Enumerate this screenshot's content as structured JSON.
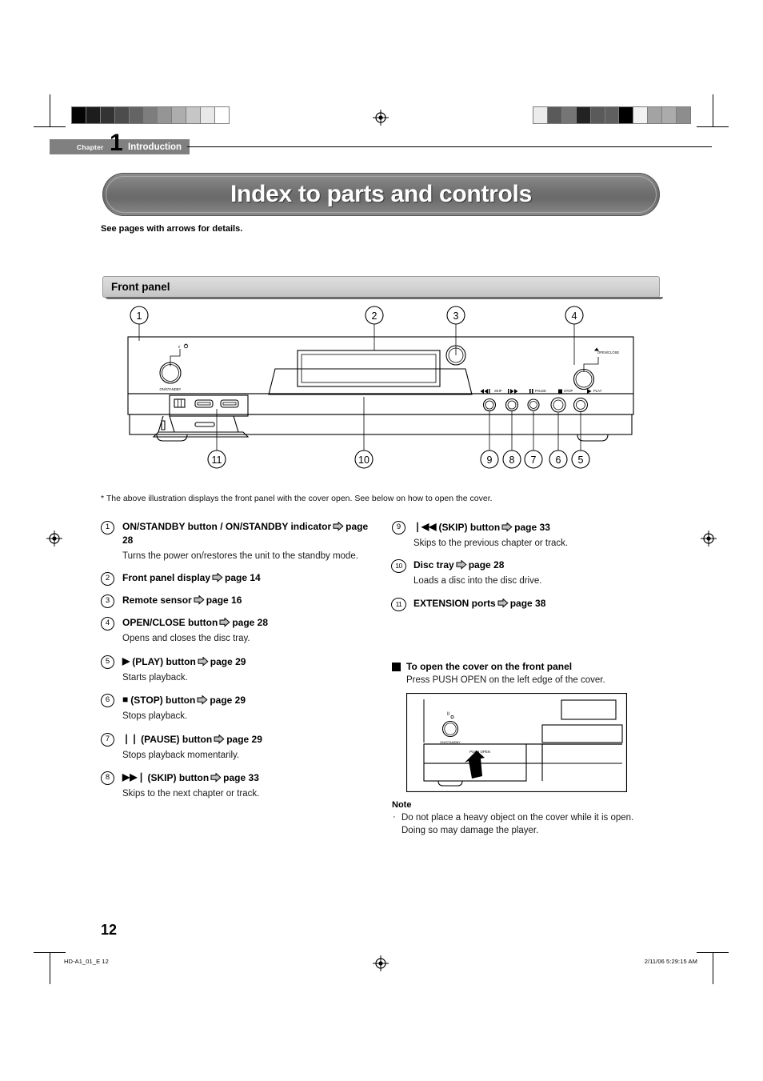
{
  "chapter": {
    "label": "Chapter",
    "number": "1",
    "section": "Introduction"
  },
  "title": "Index to parts and controls",
  "subtitle": "See pages with arrows for details.",
  "section_header": "Front panel",
  "footnote": "* The above illustration displays the front panel with the cover open. See below on how to open the cover.",
  "diagram": {
    "callouts_top": [
      "1",
      "2",
      "3",
      "4"
    ],
    "callouts_bottom": [
      "11",
      "10",
      "9",
      "8",
      "7",
      "6",
      "5"
    ],
    "labels": {
      "power_symbol": "I/⏻",
      "on_standby": "ON/STANDBY",
      "open_close": "OPEN/CLOSE",
      "skip": "SKIP",
      "pause": "PAUSE",
      "stop": "STOP",
      "play": "PLAY",
      "push_open": "PUSH OPEN"
    }
  },
  "left_items": [
    {
      "num": "1",
      "glyph": "",
      "title": "ON/STANDBY button / ON/STANDBY indicator",
      "page": "page 28",
      "desc": "Turns the power on/restores the unit to the standby mode."
    },
    {
      "num": "2",
      "glyph": "",
      "title": "Front panel display",
      "page": "page 14",
      "desc": ""
    },
    {
      "num": "3",
      "glyph": "",
      "title": "Remote sensor",
      "page": "page 16",
      "desc": ""
    },
    {
      "num": "4",
      "glyph": "",
      "title": "OPEN/CLOSE button",
      "page": "page 28",
      "desc": "Opens and closes the disc tray."
    },
    {
      "num": "5",
      "glyph": "▶",
      "title": "(PLAY) button",
      "page": "page 29",
      "desc": "Starts playback."
    },
    {
      "num": "6",
      "glyph": "■",
      "title": "(STOP) button",
      "page": "page 29",
      "desc": "Stops playback."
    },
    {
      "num": "7",
      "glyph": "❘❘",
      "title": "(PAUSE) button",
      "page": "page 29",
      "desc": "Stops playback momentarily."
    },
    {
      "num": "8",
      "glyph": "▶▶❘",
      "title": "(SKIP) button",
      "page": "page 33",
      "desc": "Skips to the next chapter or track."
    }
  ],
  "right_items": [
    {
      "num": "9",
      "glyph": "❘◀◀",
      "title": "(SKIP) button",
      "page": "page 33",
      "desc": "Skips to the previous chapter or track."
    },
    {
      "num": "10",
      "glyph": "",
      "title": "Disc tray",
      "page": "page 28",
      "desc": "Loads a disc into the disc drive."
    },
    {
      "num": "11",
      "glyph": "",
      "title": "EXTENSION ports",
      "page": "page 38",
      "desc": ""
    }
  ],
  "cover_section": {
    "heading": "To open the cover on the front panel",
    "instruction": "Press PUSH OPEN on the left edge of the cover."
  },
  "note": {
    "title": "Note",
    "bullet": "·",
    "text": "Do not place a heavy object on the cover while it is open. Doing so may damage the player."
  },
  "page_number": "12",
  "footer": {
    "left": "HD-A1_01_E   12",
    "right": "2/11/06   5:29:15 AM"
  },
  "grayscale_left": [
    "#050505",
    "#1d1d1d",
    "#333333",
    "#4c4c4c",
    "#646464",
    "#7d7d7d",
    "#959595",
    "#adadad",
    "#c6c6c6",
    "#e8e8e8",
    "#ffffff"
  ],
  "grayscale_right": [
    "#ececec",
    "#5a5a5a",
    "#757575",
    "#232323",
    "#5a5a5a",
    "#5f5f5f",
    "#000000",
    "#f2f2f2",
    "#a3a3a3",
    "#ababab",
    "#8d8d8d"
  ],
  "colors": {
    "banner_gray": "#6f6f6f",
    "section_gray": "#d2d2d2",
    "chapter_gray": "#808080",
    "arrow_fill": "#bfbfbf"
  }
}
